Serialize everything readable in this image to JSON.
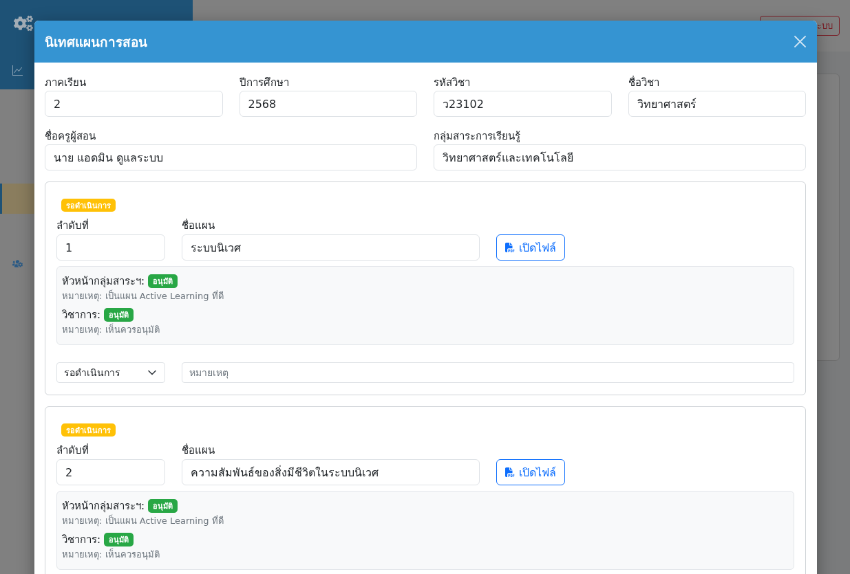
{
  "background": {
    "sidebar": {
      "items": [
        {
          "kind": "chart",
          "selected": true,
          "highlighted": false
        },
        {
          "kind": "plain",
          "selected": false,
          "highlighted": true
        },
        {
          "kind": "users",
          "selected": false,
          "highlighted": false
        }
      ]
    },
    "topbar": {
      "logout_button": "ะบบ"
    }
  },
  "modal": {
    "title": "นิเทศแผนการสอน",
    "field_rows": [
      [
        {
          "label": "ภาคเรียน",
          "value": "2"
        },
        {
          "label": "ปีการศึกษา",
          "value": "2568"
        },
        {
          "label": "รหัสวิชา",
          "value": "ว23102"
        },
        {
          "label": "ชื่อวิชา",
          "value": "วิทยาศาสตร์"
        }
      ],
      [
        {
          "label": "ชื่อครูผู้สอน",
          "value": "นาย แอดมิน ดูแลระบบ"
        },
        {
          "label": "กลุ่มสาระการเรียนรู้",
          "value": "วิทยาศาสตร์และเทคโนโลยี"
        }
      ]
    ],
    "plans": [
      {
        "status": {
          "text": "รอดำเนินการ",
          "kind": "pending"
        },
        "order_label": "ลำดับที่",
        "order": "1",
        "name_label": "ชื่อแผน",
        "name": "ระบบนิเวศ",
        "open_file_button": "เปิดไฟล์",
        "reviews": [
          {
            "role": "หัวหน้ากลุ่มสาระฯ:",
            "status": {
              "text": "อนุมัติ",
              "kind": "approved"
            },
            "note": "หมายเหตุ: เป็นแผน Active Learning ที่ดี"
          },
          {
            "role": "วิชาการ:",
            "status": {
              "text": "อนุมัติ",
              "kind": "approved"
            },
            "note": "หมายเหตุ: เห็นควรอนุมัติ"
          }
        ],
        "decision": {
          "value": "รอดำเนินการ",
          "note_placeholder": "หมายเหตุ"
        }
      },
      {
        "status": {
          "text": "รอดำเนินการ",
          "kind": "pending"
        },
        "order_label": "ลำดับที่",
        "order": "2",
        "name_label": "ชื่อแผน",
        "name": "ความสัมพันธ์ของสิ่งมีชีวิตในระบบนิเวศ",
        "open_file_button": "เปิดไฟล์",
        "reviews": [
          {
            "role": "หัวหน้ากลุ่มสาระฯ:",
            "status": {
              "text": "อนุมัติ",
              "kind": "approved"
            },
            "note": "หมายเหตุ: เป็นแผน Active Learning ที่ดี"
          },
          {
            "role": "วิชาการ:",
            "status": {
              "text": "อนุมัติ",
              "kind": "approved"
            },
            "note": "หมายเหตุ: เห็นควรอนุมัติ"
          }
        ]
      }
    ]
  }
}
